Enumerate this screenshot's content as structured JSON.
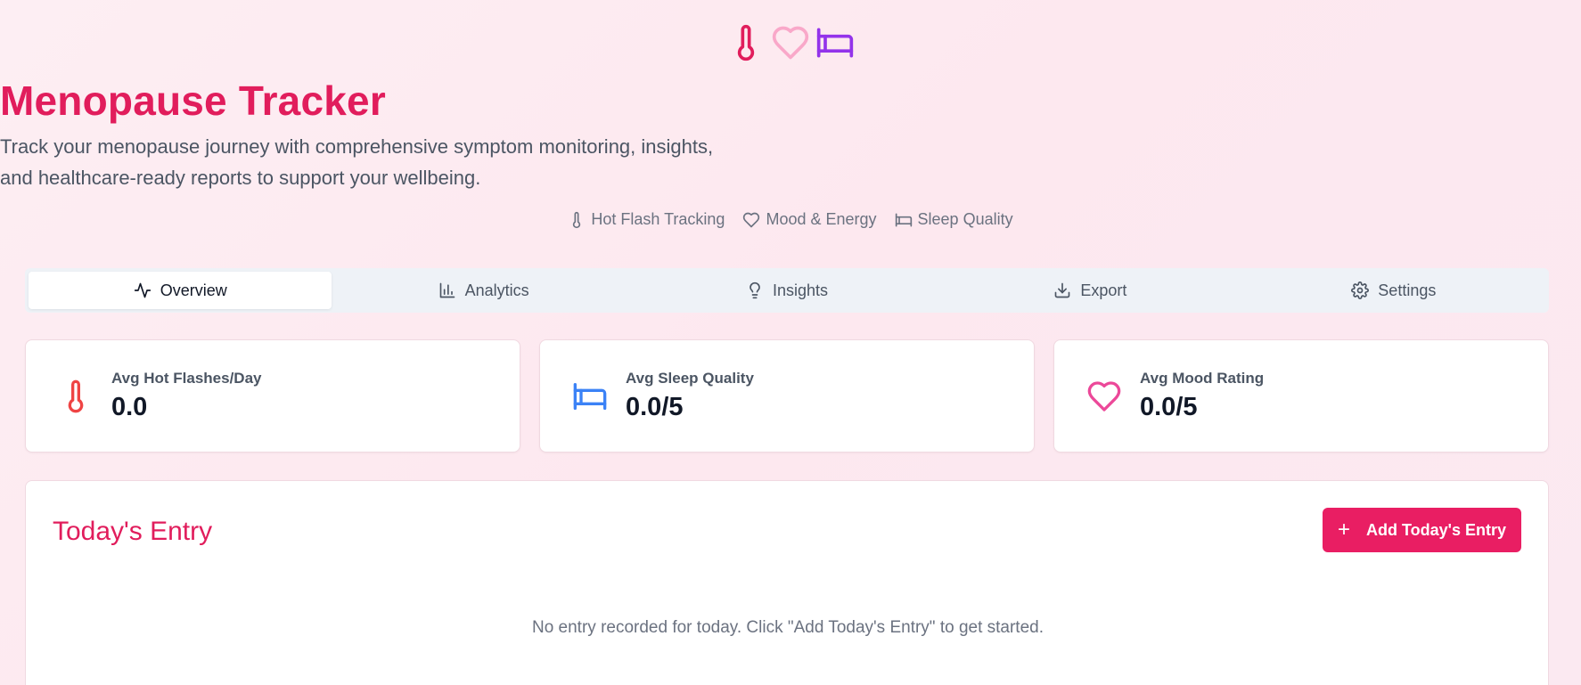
{
  "header": {
    "icons": [
      "thermometer-icon",
      "heart-icon",
      "bed-icon"
    ],
    "title": "Menopause Tracker",
    "subtitle_line1": "Track your menopause journey with comprehensive symptom monitoring, insights,",
    "subtitle_line2": "and healthcare-ready reports to support your wellbeing.",
    "features": [
      {
        "icon": "thermometer-icon",
        "label": "Hot Flash Tracking"
      },
      {
        "icon": "heart-icon",
        "label": "Mood & Energy"
      },
      {
        "icon": "bed-icon",
        "label": "Sleep Quality"
      }
    ]
  },
  "tabs": [
    {
      "icon": "activity-icon",
      "label": "Overview",
      "active": true
    },
    {
      "icon": "bar-chart-icon",
      "label": "Analytics",
      "active": false
    },
    {
      "icon": "lightbulb-icon",
      "label": "Insights",
      "active": false
    },
    {
      "icon": "download-icon",
      "label": "Export",
      "active": false
    },
    {
      "icon": "gear-icon",
      "label": "Settings",
      "active": false
    }
  ],
  "stats": [
    {
      "icon": "thermometer-icon",
      "label": "Avg Hot Flashes/Day",
      "value": "0.0",
      "color": "#ef4444"
    },
    {
      "icon": "bed-icon",
      "label": "Avg Sleep Quality",
      "value": "0.0/5",
      "color": "#3b82f6"
    },
    {
      "icon": "heart-icon",
      "label": "Avg Mood Rating",
      "value": "0.0/5",
      "color": "#ec4899"
    }
  ],
  "entry": {
    "title": "Today's Entry",
    "add_button_label": "Add Today's Entry",
    "empty_message": "No entry recorded for today. Click \"Add Today's Entry\" to get started."
  },
  "colors": {
    "brand": "#e91e63",
    "title": "#e11d5c"
  }
}
